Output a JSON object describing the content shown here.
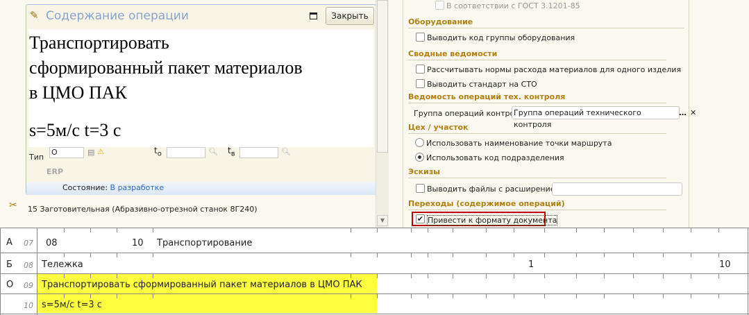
{
  "panel": {
    "title": "Содержание операции",
    "close_label": "Закрыть",
    "content_lines": [
      "Транспортировать",
      "сформированный пакет материалов",
      "в ЦМО ПАК"
    ],
    "content_params": "s=5м/с t=3 с",
    "type_label": "Тип",
    "type_value": "О",
    "to_label": "t",
    "to_sub": "о",
    "tv_label": "t",
    "tv_sub": "в",
    "erp": "ERP",
    "status_label": "Состояние:",
    "status_value": "В разработке"
  },
  "operation": "15 Заготовительная (Абразивно-отрезной станок 8Г240)",
  "settings": {
    "gost": "В соответствии с ГОСТ 3.1201-85",
    "sections": [
      {
        "title": "Оборудование"
      },
      {
        "title": "Сводные ведомости"
      },
      {
        "title": "Ведомость операций тех. контроля"
      },
      {
        "title": "Цех / участок"
      },
      {
        "title": "Эскизы"
      },
      {
        "title": "Переходы (содержимое операций)"
      }
    ],
    "equip_code": "Выводить код группы оборудования",
    "norms": "Рассчитывать нормы расхода материалов для одного изделия",
    "sto": "Выводить стандарт на СТО",
    "control_group_label": "Группа операций контроля:",
    "control_group_value": "Группа операций технического контроля",
    "route_name": "Использовать наименование точки маршрута",
    "dept_code": "Использовать код подразделения",
    "files_ext": "Выводить файлы с расширением:",
    "doc_format": "Привести к формату документа",
    "doc_format_checked": true,
    "dept_code_selected": true
  },
  "table": {
    "rows": [
      {
        "type": "А",
        "num": "07",
        "cells": [
          "08",
          "10",
          "Транспортирование"
        ]
      },
      {
        "type": "Б",
        "num": "08",
        "cells": [
          "Тележка",
          "1",
          "10"
        ]
      },
      {
        "type": "О",
        "num": "09",
        "cells": [
          "Транспортировать сформированный пакет материалов в ЦМО ПАК"
        ]
      },
      {
        "type": "",
        "num": "10",
        "cells": [
          "s=5м/с t=3 с"
        ]
      }
    ],
    "highlight_color": "#ffff40"
  }
}
